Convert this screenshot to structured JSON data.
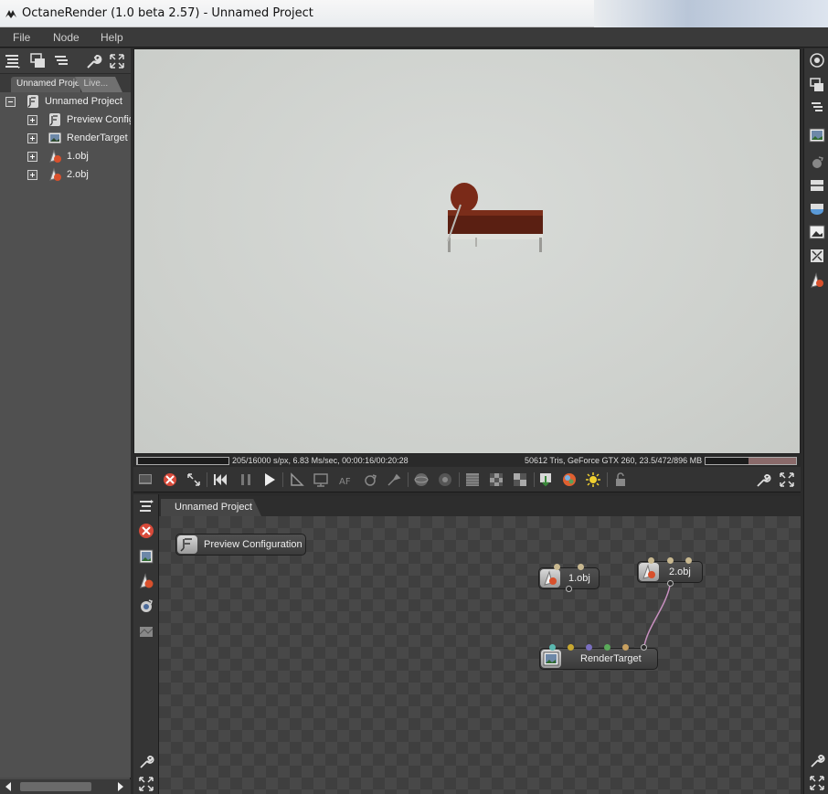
{
  "window": {
    "title": "OctaneRender (1.0 beta 2.57) - Unnamed Project"
  },
  "menu": [
    {
      "label": "File"
    },
    {
      "label": "Node"
    },
    {
      "label": "Help"
    }
  ],
  "left_panel": {
    "tabs": [
      {
        "label": "Unnamed Project"
      },
      {
        "label": "Live..."
      }
    ],
    "tree": [
      {
        "label": "Unnamed Project",
        "icon": "project-icon",
        "expanded": true
      },
      {
        "label": "Preview Configuration",
        "icon": "render-settings-icon"
      },
      {
        "label": "RenderTarget",
        "icon": "render-target-icon"
      },
      {
        "label": "1.obj",
        "icon": "mesh-icon"
      },
      {
        "label": "2.obj",
        "icon": "mesh-icon"
      }
    ]
  },
  "viewport": {
    "status_left": "205/16000 s/px, 6.83 Ms/sec, 00:00:16/00:20:28",
    "status_right": "50612 Tris, GeForce GTX 260, 23.5/472/896 MB",
    "render_progress": 0.013,
    "memory_usage": 0.53
  },
  "node_graph": {
    "tab": "Unnamed Project",
    "nodes": [
      {
        "label": "Preview Configuration",
        "icon": "render-settings-icon"
      },
      {
        "label": "1.obj",
        "icon": "mesh-icon"
      },
      {
        "label": "2.obj",
        "icon": "mesh-icon"
      },
      {
        "label": "RenderTarget",
        "icon": "render-target-icon"
      }
    ],
    "pin_colors": [
      "#5ab8b0",
      "#c8a830",
      "#7a6fc0",
      "#5aaa5a",
      "#c8a060",
      "#c8b890"
    ]
  },
  "colors": {
    "background": "#2b2b2b",
    "panel": "#4a4a4a",
    "connection": "#c890c0"
  }
}
